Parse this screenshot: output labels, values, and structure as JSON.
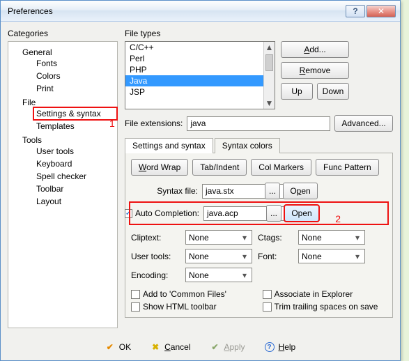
{
  "window": {
    "title": "Preferences"
  },
  "categories": {
    "label": "Categories",
    "items": [
      {
        "label": "General",
        "children": [
          "Fonts",
          "Colors",
          "Print"
        ]
      },
      {
        "label": "File",
        "children": [
          "Settings & syntax",
          "Templates"
        ]
      },
      {
        "label": "Tools",
        "children": [
          "User tools",
          "Keyboard",
          "Spell checker",
          "Toolbar",
          "Layout"
        ]
      }
    ],
    "selected": "Settings & syntax"
  },
  "filetypes": {
    "label": "File types",
    "items": [
      "C/C++",
      "Perl",
      "PHP",
      "Java",
      "JSP"
    ],
    "selected": "Java"
  },
  "buttons": {
    "add": "Add...",
    "remove": "Remove",
    "up": "Up",
    "down": "Down",
    "advanced": "Advanced...",
    "wordwrap": "Word Wrap",
    "tabindent": "Tab/Indent",
    "colmarkers": "Col Markers",
    "funcpattern": "Func Pattern",
    "open": "Open",
    "browse": "...",
    "ok": "OK",
    "cancel": "Cancel",
    "apply": "Apply",
    "help": "Help"
  },
  "ext": {
    "label": "File extensions:",
    "value": "java"
  },
  "tabs": {
    "settings": "Settings and syntax",
    "syntax": "Syntax colors"
  },
  "fields": {
    "syntaxfile_label": "Syntax file:",
    "syntaxfile_value": "java.stx",
    "autocomp_label": "Auto Completion:",
    "autocomp_value": "java.acp",
    "autocomp_checked": true,
    "cliptext_label": "Cliptext:",
    "cliptext_value": "None",
    "ctags_label": "Ctags:",
    "ctags_value": "None",
    "usertools_label": "User tools:",
    "usertools_value": "None",
    "font_label": "Font:",
    "font_value": "None",
    "encoding_label": "Encoding:",
    "encoding_value": "None"
  },
  "checks": {
    "commonfiles": "Add to 'Common Files'",
    "associate": "Associate in Explorer",
    "htmltoolbar": "Show HTML toolbar",
    "trim": "Trim trailing spaces on save"
  },
  "annotations": {
    "one": "1",
    "two": "2"
  }
}
